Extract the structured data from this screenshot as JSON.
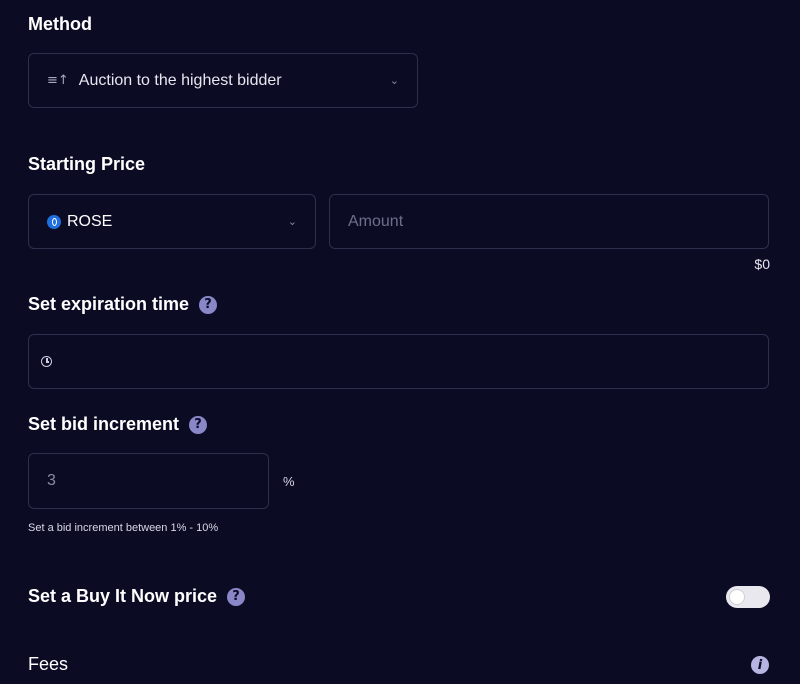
{
  "method": {
    "label": "Method",
    "selected": "Auction to the highest bidder",
    "icon": "sort-ascending-icon"
  },
  "starting_price": {
    "label": "Starting Price",
    "currency": "ROSE",
    "currency_icon": "rose-token-icon",
    "amount_placeholder": "Amount",
    "usd_value": "$0"
  },
  "expiration": {
    "label": "Set expiration time",
    "help": "?",
    "icon": "clock-icon"
  },
  "bid_increment": {
    "label": "Set bid increment",
    "help": "?",
    "value": "3",
    "unit": "%",
    "hint": "Set a bid increment between 1% - 10%"
  },
  "buy_now": {
    "label": "Set a Buy It Now price",
    "help": "?",
    "enabled": false
  },
  "fees": {
    "label": "Fees",
    "info": "i"
  },
  "colors": {
    "background": "#0c0b24",
    "border": "#2f2e4c",
    "help_icon": "#8a87c9",
    "rose_blue": "#1f6fe0"
  }
}
